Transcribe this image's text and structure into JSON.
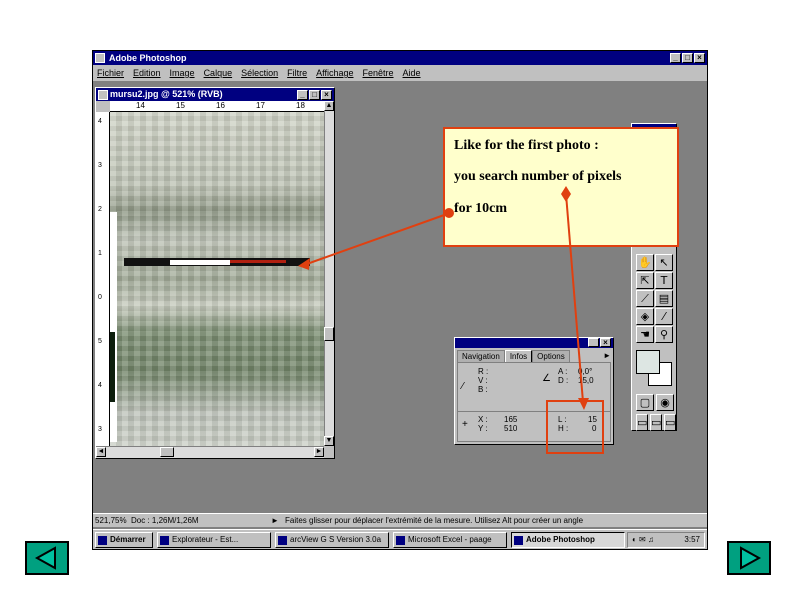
{
  "app": {
    "title": "Adobe Photoshop",
    "menu": [
      "Fichier",
      "Edition",
      "Image",
      "Calque",
      "Sélection",
      "Filtre",
      "Affichage",
      "Fenêtre",
      "Aide"
    ]
  },
  "document": {
    "title": "mursu2.jpg @ 521% (RVB)",
    "ruler_h": [
      "14",
      "15",
      "16",
      "17",
      "18"
    ],
    "ruler_v": [
      "4",
      "3",
      "2",
      "1",
      "0",
      "5",
      "4",
      "3"
    ]
  },
  "info_palette": {
    "tabs": [
      "Navigation",
      "Infos",
      "Options"
    ],
    "active_tab": "Infos",
    "rgb": "R :\nV :\nB :",
    "angle_label": "A :",
    "angle_value": "0,0°",
    "distance_label": "D :",
    "distance_value": "15,0",
    "x_label": "X :",
    "x_value": "165",
    "y_label": "Y :",
    "y_value": "510",
    "l_label": "L :",
    "l_value": "15",
    "h_label": "H :",
    "h_value": "0"
  },
  "statusbar": {
    "zoom": "521,75%",
    "doc": "Doc : 1,26M/1,26M",
    "hint": "Faites glisser pour déplacer l'extrémité de la mesure. Utilisez Alt pour créer un angle"
  },
  "taskbar": {
    "start": "Démarrer",
    "tasks": [
      "Explorateur - Est...",
      "arcView G S Version 3.0a",
      "Microsoft Excel - paage",
      "Adobe Photoshop"
    ],
    "active_task": "Adobe Photoshop",
    "clock": "3:57"
  },
  "callout": {
    "line1": "Like for the first photo :",
    "line2": "you search number of pixels",
    "line3": "for 10cm"
  },
  "colors": {
    "accent_red": "#e04010",
    "callout_bg": "#ffffcc",
    "nav_green": "#00a080",
    "titlebar": "#000080"
  }
}
